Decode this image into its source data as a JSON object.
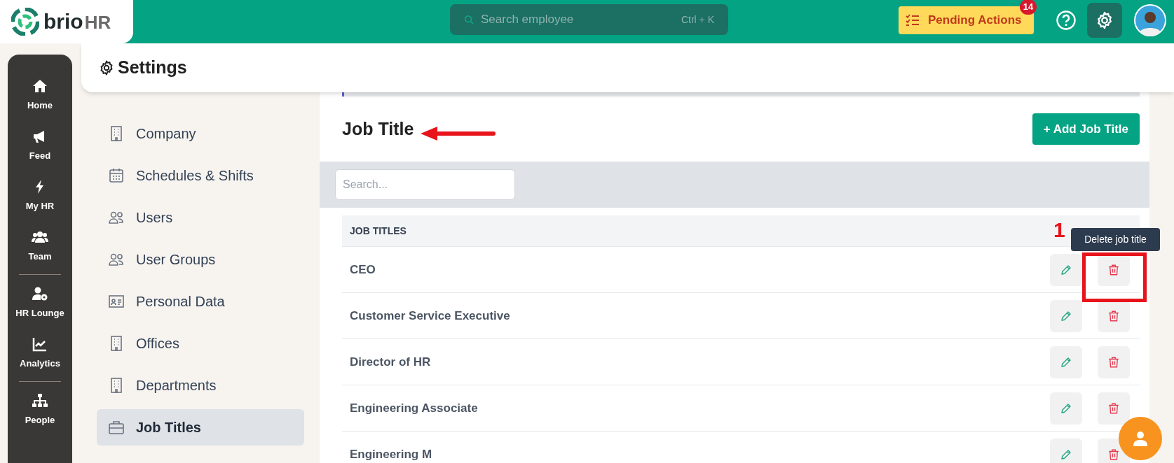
{
  "header": {
    "logo": {
      "word": "brio",
      "suffix": "HR"
    },
    "search": {
      "placeholder": "Search employee",
      "shortcut": "Ctrl + K"
    },
    "pending_actions": {
      "label": "Pending Actions",
      "count": "14"
    }
  },
  "rail": [
    {
      "label": "Home",
      "divider_after": false
    },
    {
      "label": "Feed",
      "divider_after": false
    },
    {
      "label": "My HR",
      "divider_after": false
    },
    {
      "label": "Team",
      "divider_after": true
    },
    {
      "label": "HR Lounge",
      "divider_after": false
    },
    {
      "label": "Analytics",
      "divider_after": true
    },
    {
      "label": "People",
      "divider_after": false
    }
  ],
  "page_title": "Settings",
  "settings_nav": [
    {
      "label": "Company",
      "selected": false
    },
    {
      "label": "Schedules & Shifts",
      "selected": false
    },
    {
      "label": "Users",
      "selected": false
    },
    {
      "label": "User Groups",
      "selected": false
    },
    {
      "label": "Personal Data",
      "selected": false
    },
    {
      "label": "Offices",
      "selected": false
    },
    {
      "label": "Departments",
      "selected": false
    },
    {
      "label": "Job Titles",
      "selected": true
    }
  ],
  "section": {
    "title": "Job Title",
    "add_button": "+ Add Job Title",
    "search": {
      "placeholder": "Search..."
    },
    "table": {
      "columns": [
        "JOB TITLES"
      ],
      "rows": [
        {
          "title": "CEO"
        },
        {
          "title": "Customer Service Executive"
        },
        {
          "title": "Director of HR"
        },
        {
          "title": "Engineering Associate"
        },
        {
          "title": "Engineering M"
        }
      ]
    }
  },
  "tooltip": "Delete job title",
  "annotation": {
    "number": "1"
  }
}
